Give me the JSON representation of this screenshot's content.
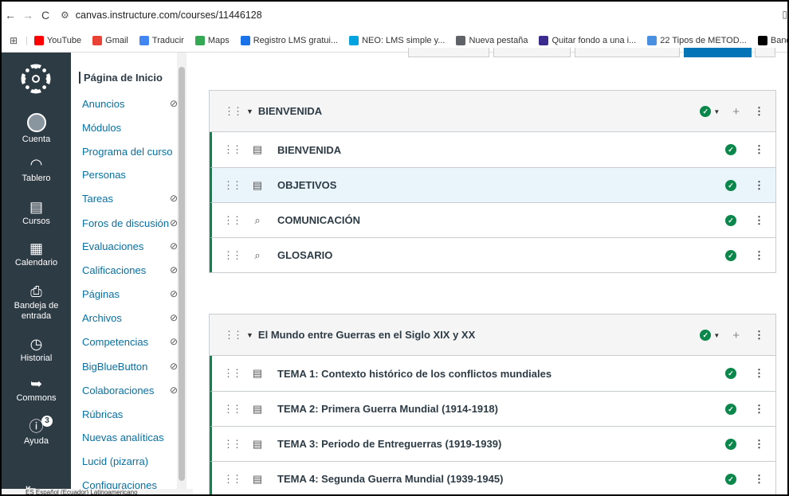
{
  "browser": {
    "url": "canvas.instructure.com/courses/11446128",
    "bookmarks": [
      {
        "label": "YouTube",
        "color": "#ff0000"
      },
      {
        "label": "Gmail",
        "color": "#ea4335"
      },
      {
        "label": "Traducir",
        "color": "#4285f4"
      },
      {
        "label": "Maps",
        "color": "#34a853"
      },
      {
        "label": "Registro LMS gratui...",
        "color": "#1a73e8"
      },
      {
        "label": "NEO: LMS simple y...",
        "color": "#00a3e0"
      },
      {
        "label": "Nueva pestaña",
        "color": "#5f6368"
      },
      {
        "label": "Quitar fondo a una i...",
        "color": "#3b2b8f"
      },
      {
        "label": "22 Tipos de METOD...",
        "color": "#4a90e2"
      },
      {
        "label": "Banco de imáge",
        "color": "#000000"
      }
    ]
  },
  "global_nav": {
    "items": [
      {
        "label": "Cuenta",
        "icon": "user-avatar-icon"
      },
      {
        "label": "Tablero",
        "icon": "dashboard-icon"
      },
      {
        "label": "Cursos",
        "icon": "courses-icon"
      },
      {
        "label": "Calendario",
        "icon": "calendar-icon"
      },
      {
        "label": "Bandeja de entrada",
        "icon": "inbox-icon"
      },
      {
        "label": "Historial",
        "icon": "history-icon"
      },
      {
        "label": "Commons",
        "icon": "commons-icon"
      },
      {
        "label": "Ayuda",
        "icon": "help-icon",
        "badge": "3"
      }
    ]
  },
  "course_nav": {
    "items": [
      {
        "label": "Página de Inicio",
        "hidden": false
      },
      {
        "label": "Anuncios",
        "hidden": true
      },
      {
        "label": "Módulos",
        "hidden": false
      },
      {
        "label": "Programa del curso",
        "hidden": false
      },
      {
        "label": "Personas",
        "hidden": false
      },
      {
        "label": "Tareas",
        "hidden": true
      },
      {
        "label": "Foros de discusión",
        "hidden": true
      },
      {
        "label": "Evaluaciones",
        "hidden": true
      },
      {
        "label": "Calificaciones",
        "hidden": true
      },
      {
        "label": "Páginas",
        "hidden": true
      },
      {
        "label": "Archivos",
        "hidden": true
      },
      {
        "label": "Competencias",
        "hidden": true
      },
      {
        "label": "BigBlueButton",
        "hidden": true
      },
      {
        "label": "Colaboraciones",
        "hidden": true
      },
      {
        "label": "Rúbricas",
        "hidden": false
      },
      {
        "label": "Nuevas analíticas",
        "hidden": false
      },
      {
        "label": "Lucid (pizarra)",
        "hidden": false
      },
      {
        "label": "Configuraciones",
        "hidden": false
      }
    ]
  },
  "status_bar": {
    "text": "ES Español (Ecuador)      Latinoamericano"
  },
  "modules": [
    {
      "title": "BIENVENIDA",
      "items": [
        {
          "title": "BIENVENIDA",
          "type": "page"
        },
        {
          "title": "OBJETIVOS",
          "type": "page"
        },
        {
          "title": "COMUNICACIÓN",
          "type": "discussion"
        },
        {
          "title": "GLOSARIO",
          "type": "discussion"
        }
      ]
    },
    {
      "title": "El Mundo entre Guerras en el Siglo XIX y XX",
      "items": [
        {
          "title": "TEMA 1: Contexto histórico de los conflictos mundiales",
          "type": "page"
        },
        {
          "title": "TEMA 2: Primera Guerra Mundial (1914-1918)",
          "type": "page"
        },
        {
          "title": "TEMA 3: Periodo de Entreguerras (1919-1939)",
          "type": "page"
        },
        {
          "title": "TEMA 4: Segunda Guerra Mundial (1939-1945)",
          "type": "page"
        }
      ]
    }
  ],
  "colors": {
    "nav_bg": "#2d3b45",
    "link": "#0770a3",
    "published": "#0b874b"
  }
}
